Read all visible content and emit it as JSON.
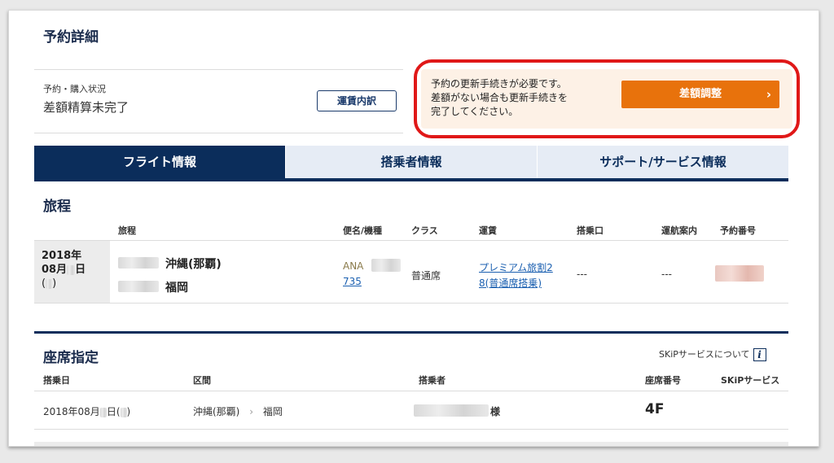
{
  "page_title": "予約詳細",
  "status": {
    "label": "予約・購入状況",
    "value": "差額精算未完了",
    "fare_breakdown_button": "運賃内訳"
  },
  "notice": {
    "lines": [
      "予約の更新手続きが必要です。",
      "差額がない場合も更新手続きを",
      "完了してください。"
    ],
    "adjust_button": "差額調整",
    "adjust_chevron": "›",
    "accent_color": "#e8720c",
    "highlight_border_color": "#e01818"
  },
  "tabs": [
    {
      "label": "フライト情報",
      "active": true
    },
    {
      "label": "搭乗者情報",
      "active": false
    },
    {
      "label": "サポート/サービス情報",
      "active": false
    }
  ],
  "itinerary": {
    "title": "旅程",
    "headers": {
      "route": "旅程",
      "flight": "便名/機種",
      "class": "クラス",
      "fare": "運賃",
      "gate": "搭乗口",
      "operation": "運航案内",
      "booking": "予約番号"
    },
    "row": {
      "date_year": "2018年",
      "date_month": "08月",
      "date_day_suffix": "日",
      "date_paren_open": "(",
      "date_paren_close": ")",
      "departure": "沖縄(那覇)",
      "arrival": "福岡",
      "airline": "ANA",
      "flight_number": "735",
      "class": "普通席",
      "fare_line1": "プレミアム旅割2",
      "fare_line2": "8(普通席搭乗)",
      "gate": "---",
      "operation": "---"
    }
  },
  "seat": {
    "title": "座席指定",
    "skip_link": "SKiPサービスについて",
    "skip_icon": "i",
    "headers": {
      "date": "搭乗日",
      "segment": "区間",
      "passenger": "搭乗者",
      "seat_number": "座席番号",
      "skip": "SKiPサービス"
    },
    "row": {
      "date_prefix": "2018年08月",
      "date_day": "日(",
      "date_close": ")",
      "from": "沖縄(那覇)",
      "arrow": "›",
      "to": "福岡",
      "passenger_suffix": "様",
      "seat_number": "4F"
    }
  },
  "brand_color": "#0b2d5b"
}
